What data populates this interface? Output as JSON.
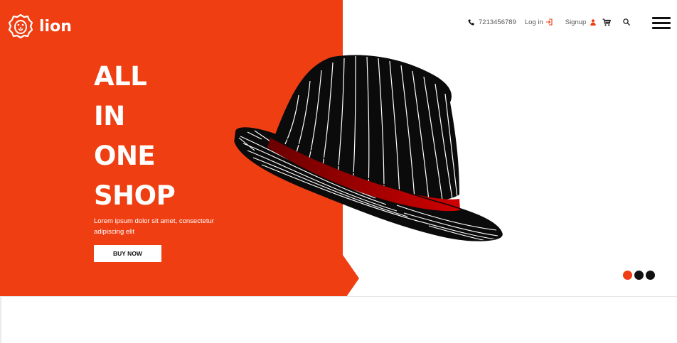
{
  "brand": {
    "name": "lion",
    "accent_color": "#ee3e12",
    "dark_color": "#111111"
  },
  "nav": {
    "phone": "7213456789",
    "login": "Log in",
    "signup": "Signup"
  },
  "hero": {
    "headline_lines": [
      "ALL",
      "IN",
      "ONE",
      "SHOP"
    ],
    "description": "Lorem ipsum dolor sit amet, consectetur adipiscing elit",
    "cta_label": "BUY NOW",
    "image": "striped-fedora-hat"
  },
  "slider": {
    "total_slides": 3,
    "active_index": 0,
    "active_color": "#ee3e12",
    "inactive_color": "#111111"
  },
  "icons": {
    "logo": "lion-head-icon",
    "phone": "phone-icon",
    "login": "login-icon",
    "signup": "user-icon",
    "cart": "cart-icon",
    "search": "search-icon",
    "menu": "hamburger-menu-icon"
  }
}
